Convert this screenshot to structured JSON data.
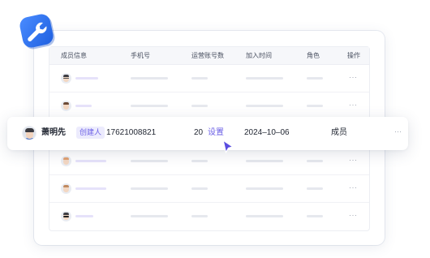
{
  "table": {
    "headers": [
      "成员信息",
      "手机号",
      "运营账号数",
      "加入时间",
      "角色",
      "操作"
    ],
    "more_label": "···"
  },
  "highlight_row": {
    "name": "萧明先",
    "badge": "创建人",
    "phone": "17621008821",
    "account_count": "20",
    "settings_link": "设置",
    "join_date": "2024–10–06",
    "role": "成员",
    "more_label": "···"
  },
  "colors": {
    "accent": "#6b5fe6",
    "logo_blue": "#2f73f0",
    "badge_bg": "#ecebfd"
  },
  "icons": {
    "logo": "wrench-icon",
    "cursor": "pointer-arrow-icon"
  }
}
